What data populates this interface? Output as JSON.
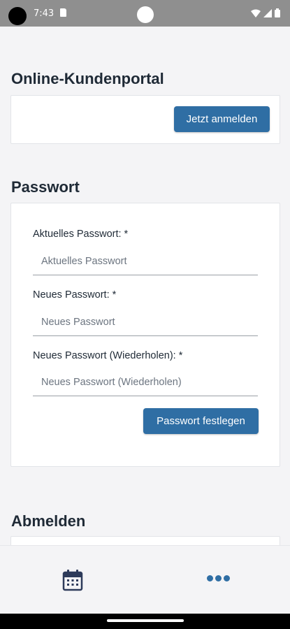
{
  "status_bar": {
    "time": "7:43"
  },
  "portal": {
    "title": "Online-Kundenportal",
    "login_button": "Jetzt anmelden"
  },
  "password": {
    "title": "Passwort",
    "current": {
      "label": "Aktuelles Passwort: *",
      "placeholder": "Aktuelles Passwort"
    },
    "new": {
      "label": "Neues Passwort: *",
      "placeholder": "Neues Passwort"
    },
    "repeat": {
      "label": "Neues Passwort (Wiederholen): *",
      "placeholder": "Neues Passwort (Wiederholen)"
    },
    "submit_button": "Passwort festlegen"
  },
  "logout": {
    "title": "Abmelden"
  },
  "bottom_nav": {
    "items": [
      {
        "icon": "calendar-icon"
      },
      {
        "icon": "more-dots-icon"
      }
    ]
  },
  "colors": {
    "accent": "#2f6ea4",
    "background": "#f4f4f6",
    "text": "#1f2a36"
  }
}
